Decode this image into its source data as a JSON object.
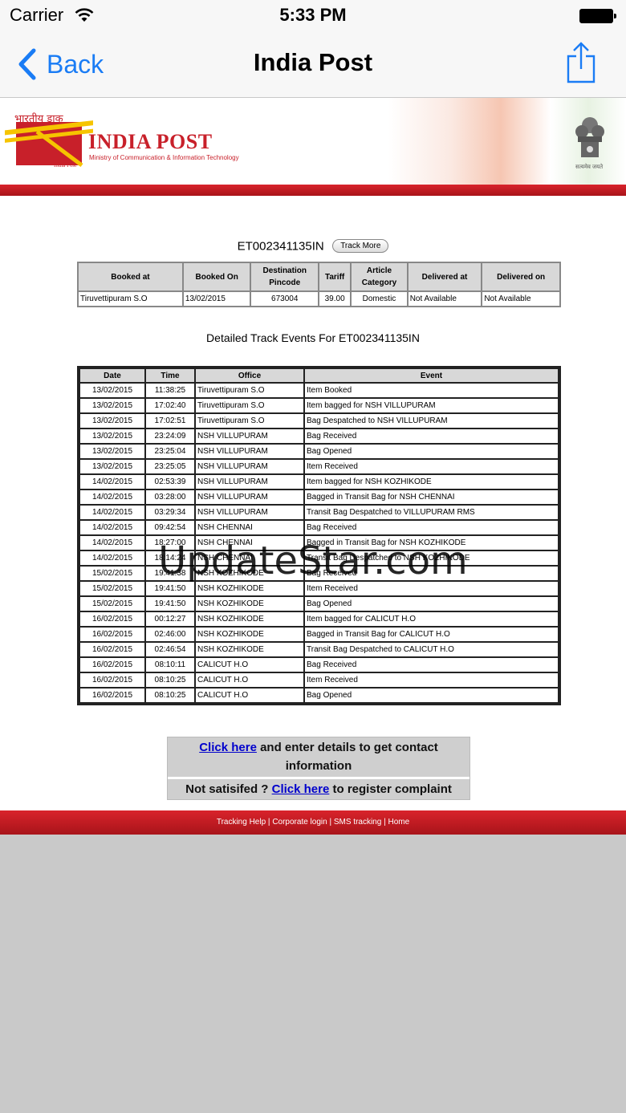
{
  "status_bar": {
    "carrier": "Carrier",
    "time": "5:33 PM"
  },
  "nav": {
    "back_label": "Back",
    "title": "India Post"
  },
  "banner": {
    "hindi_text": "भारतीय डाक",
    "logo_title": "INDIA POST",
    "logo_subtitle": "Ministry of Communication & Information Technology",
    "logo_caption": "India Post",
    "emblem_caption": "सत्यमेव जयते"
  },
  "tracking": {
    "id": "ET002341135IN",
    "track_more_label": "Track More",
    "summary_headers": [
      "Booked at",
      "Booked On",
      "Destination Pincode",
      "Tariff",
      "Article Category",
      "Delivered at",
      "Delivered on"
    ],
    "summary_row": [
      "Tiruvettipuram S.O",
      "13/02/2015",
      "673004",
      "39.00",
      "Domestic",
      "Not Available",
      "Not Available"
    ],
    "detail_title": "Detailed Track Events For ET002341135IN",
    "event_headers": [
      "Date",
      "Time",
      "Office",
      "Event"
    ],
    "events": [
      [
        "13/02/2015",
        "11:38:25",
        "Tiruvettipuram S.O",
        "Item Booked"
      ],
      [
        "13/02/2015",
        "17:02:40",
        "Tiruvettipuram S.O",
        "Item bagged for NSH VILLUPURAM"
      ],
      [
        "13/02/2015",
        "17:02:51",
        "Tiruvettipuram S.O",
        "Bag Despatched to NSH VILLUPURAM"
      ],
      [
        "13/02/2015",
        "23:24:09",
        "NSH VILLUPURAM",
        "Bag Received"
      ],
      [
        "13/02/2015",
        "23:25:04",
        "NSH VILLUPURAM",
        "Bag Opened"
      ],
      [
        "13/02/2015",
        "23:25:05",
        "NSH VILLUPURAM",
        "Item Received"
      ],
      [
        "14/02/2015",
        "02:53:39",
        "NSH VILLUPURAM",
        "Item bagged for NSH KOZHIKODE"
      ],
      [
        "14/02/2015",
        "03:28:00",
        "NSH VILLUPURAM",
        "Bagged in Transit Bag for NSH CHENNAI"
      ],
      [
        "14/02/2015",
        "03:29:34",
        "NSH VILLUPURAM",
        "Transit Bag Despatched to VILLUPURAM RMS"
      ],
      [
        "14/02/2015",
        "09:42:54",
        "NSH CHENNAI",
        "Bag Received"
      ],
      [
        "14/02/2015",
        "18:27:00",
        "NSH CHENNAI",
        "Bagged in Transit Bag for NSH KOZHIKODE"
      ],
      [
        "14/02/2015",
        "18:14:24",
        "NSH CHENNAI",
        "Transit Bag Despatched to NSH KOZHIKODE"
      ],
      [
        "15/02/2015",
        "19:41:38",
        "NSH KOZHIKODE",
        "Bag Received"
      ],
      [
        "15/02/2015",
        "19:41:50",
        "NSH KOZHIKODE",
        "Item Received"
      ],
      [
        "15/02/2015",
        "19:41:50",
        "NSH KOZHIKODE",
        "Bag Opened"
      ],
      [
        "16/02/2015",
        "00:12:27",
        "NSH KOZHIKODE",
        "Item bagged for CALICUT H.O"
      ],
      [
        "16/02/2015",
        "02:46:00",
        "NSH KOZHIKODE",
        "Bagged in Transit Bag for CALICUT H.O"
      ],
      [
        "16/02/2015",
        "02:46:54",
        "NSH KOZHIKODE",
        "Transit Bag Despatched to CALICUT H.O"
      ],
      [
        "16/02/2015",
        "08:10:11",
        "CALICUT H.O",
        "Bag Received"
      ],
      [
        "16/02/2015",
        "08:10:25",
        "CALICUT H.O",
        "Item Received"
      ],
      [
        "16/02/2015",
        "08:10:25",
        "CALICUT H.O",
        "Bag Opened"
      ]
    ]
  },
  "watermark": "UpdateStar.com",
  "contact": {
    "link1": "Click here",
    "text1": " and enter details to get contact information",
    "prefix2": "Not satisifed ? ",
    "link2": "Click here",
    "text2": " to register complaint"
  },
  "footer": {
    "links": [
      "Tracking Help",
      "Corporate login",
      "SMS tracking",
      "Home"
    ],
    "separator": " | "
  },
  "colors": {
    "ios_blue": "#1a7cf5",
    "india_post_red": "#c8202a",
    "footer_red": "#b8181f"
  },
  "icons": [
    "wifi-icon",
    "battery-icon",
    "back-chevron-icon",
    "share-icon",
    "india-post-logo",
    "national-emblem"
  ]
}
